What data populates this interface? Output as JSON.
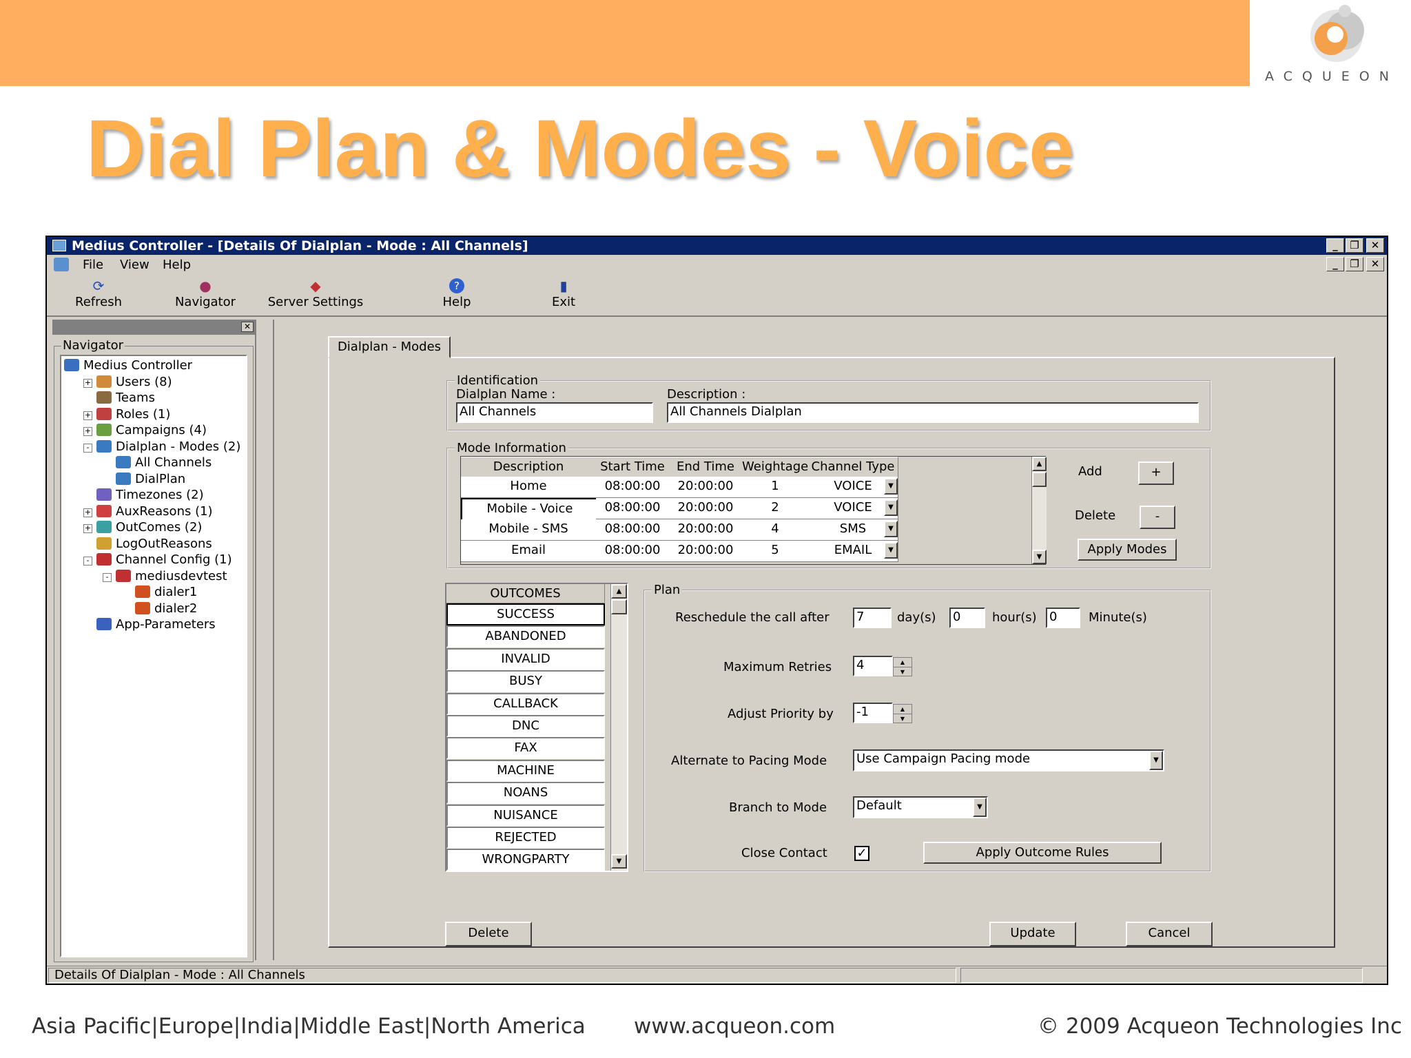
{
  "slide": {
    "title": "Dial Plan & Modes - Voice",
    "logo_text": "ACQUEON",
    "footer_regions": "Asia Pacific|Europe|India|Middle East|North America",
    "footer_url": "www.acqueon.com",
    "footer_copyright": "© 2009 Acqueon Technologies Inc",
    "accent_color": "#ffad5e"
  },
  "window": {
    "title": "Medius Controller - [Details Of Dialplan - Mode : All Channels]",
    "menu": [
      "File",
      "View",
      "Help"
    ],
    "toolbar": [
      {
        "label": "Refresh",
        "icon": "refresh-icon"
      },
      {
        "label": "Navigator",
        "icon": "navigator-icon"
      },
      {
        "label": "Server Settings",
        "icon": "server-settings-icon"
      },
      {
        "label": "Help",
        "icon": "help-icon"
      },
      {
        "label": "Exit",
        "icon": "exit-icon"
      }
    ],
    "status_text": "Details Of Dialplan - Mode :  All Channels"
  },
  "navigator": {
    "label": "Navigator",
    "tree": [
      {
        "label": "Medius Controller",
        "level": 0,
        "expander": ""
      },
      {
        "label": "Users (8)",
        "level": 1,
        "expander": "+"
      },
      {
        "label": "Teams",
        "level": 1,
        "expander": ""
      },
      {
        "label": "Roles (1)",
        "level": 1,
        "expander": "+"
      },
      {
        "label": "Campaigns (4)",
        "level": 1,
        "expander": "+"
      },
      {
        "label": "Dialplan - Modes (2)",
        "level": 1,
        "expander": "-"
      },
      {
        "label": "All Channels",
        "level": 2,
        "expander": ""
      },
      {
        "label": "DialPlan",
        "level": 2,
        "expander": ""
      },
      {
        "label": "Timezones (2)",
        "level": 1,
        "expander": ""
      },
      {
        "label": "AuxReasons (1)",
        "level": 1,
        "expander": "+"
      },
      {
        "label": "OutComes (2)",
        "level": 1,
        "expander": "+"
      },
      {
        "label": "LogOutReasons",
        "level": 1,
        "expander": ""
      },
      {
        "label": "Channel Config (1)",
        "level": 1,
        "expander": "-"
      },
      {
        "label": "mediusdevtest",
        "level": 2,
        "expander": "-"
      },
      {
        "label": "dialer1",
        "level": 3,
        "expander": ""
      },
      {
        "label": "dialer2",
        "level": 3,
        "expander": ""
      },
      {
        "label": "App-Parameters",
        "level": 1,
        "expander": ""
      }
    ]
  },
  "tab": {
    "label": "Dialplan - Modes"
  },
  "identification": {
    "group_label": "Identification",
    "name_label": "Dialplan Name :",
    "name_value": "All Channels",
    "desc_label": "Description :",
    "desc_value": "All Channels Dialplan"
  },
  "mode_info": {
    "group_label": "Mode Information",
    "columns": [
      "Description",
      "Start Time",
      "End Time",
      "Weightage",
      "Channel Type"
    ],
    "rows": [
      [
        "Home",
        "08:00:00",
        "20:00:00",
        "1",
        "VOICE"
      ],
      [
        "Mobile - Voice",
        "08:00:00",
        "20:00:00",
        "2",
        "VOICE"
      ],
      [
        "Mobile - SMS",
        "08:00:00",
        "20:00:00",
        "4",
        "SMS"
      ],
      [
        "Email",
        "08:00:00",
        "20:00:00",
        "5",
        "EMAIL"
      ]
    ],
    "add_label": "Add",
    "add_button": "+",
    "delete_label": "Delete",
    "delete_button": "-",
    "apply_modes": "Apply Modes"
  },
  "outcomes": {
    "header": "OUTCOMES",
    "items": [
      "SUCCESS",
      "ABANDONED",
      "INVALID",
      "BUSY",
      "CALLBACK",
      "DNC",
      "FAX",
      "MACHINE",
      "NOANS",
      "NUISANCE",
      "REJECTED",
      "WRONGPARTY"
    ]
  },
  "plan": {
    "group_label": "Plan",
    "reschedule_label": "Reschedule the call after",
    "days_value": "7",
    "days_unit": "day(s)",
    "hours_value": "0",
    "hours_unit": "hour(s)",
    "minutes_value": "0",
    "minutes_unit": "Minute(s)",
    "max_retries_label": "Maximum Retries",
    "max_retries_value": "4",
    "adjust_priority_label": "Adjust Priority by",
    "adjust_priority_value": "-1",
    "alt_pacing_label": "Alternate to Pacing Mode",
    "alt_pacing_value": "Use Campaign Pacing mode",
    "branch_label": "Branch to Mode",
    "branch_value": "Default",
    "close_contact_label": "Close Contact",
    "close_contact_checked": true,
    "apply_outcome_rules": "Apply Outcome Rules"
  },
  "footer_buttons": {
    "delete": "Delete",
    "update": "Update",
    "cancel": "Cancel"
  }
}
